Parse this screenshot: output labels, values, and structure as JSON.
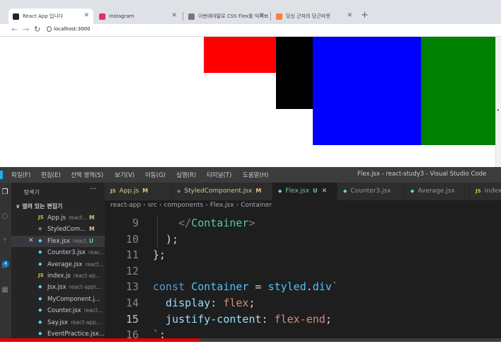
{
  "browser": {
    "tabs": [
      {
        "label": "React App 입니다",
        "favicon_color": "#20232a",
        "active": true
      },
      {
        "label": "Instagram",
        "favicon_color": "#e1306c",
        "active": false
      },
      {
        "label": "이번에야말로 CSS Flex를 익혀보자",
        "favicon_color": "#777777",
        "active": false
      },
      {
        "label": "당신 근처의 당근마켓",
        "favicon_color": "#ff7e36",
        "active": false
      }
    ],
    "new_tab": "+",
    "url": "localhost:3000",
    "boxes": [
      {
        "color": "#ff0000",
        "name": "red-box"
      },
      {
        "color": "#000000",
        "name": "black-box"
      },
      {
        "color": "#0000ff",
        "name": "blue-box"
      },
      {
        "color": "#008000",
        "name": "green-box"
      }
    ]
  },
  "vscode": {
    "menu": [
      "파일(F)",
      "편집(E)",
      "선택 영역(S)",
      "보기(V)",
      "이동(G)",
      "실행(R)",
      "터미널(T)",
      "도움말(H)"
    ],
    "window_title": "Flex.jsx - react-study3 - Visual Studio Code",
    "scm_badge": "4",
    "explorer": {
      "title": "탐색기",
      "dots": "···",
      "open_editors": "∨ 열려 있는 편집기",
      "files": [
        {
          "icon": "JS",
          "icon_color": "#cbcb41",
          "name": "App.js",
          "path": "react...",
          "status": "M",
          "status_color": "#e2c08d",
          "active": false
        },
        {
          "icon": "◆",
          "icon_color": "#6d8086",
          "name": "StyledCom...",
          "path": "",
          "status": "M",
          "status_color": "#e2c08d",
          "active": false
        },
        {
          "icon": "◆",
          "icon_color": "#61dafb",
          "name": "Flex.jsx",
          "path": "react...",
          "status": "U",
          "status_color": "#73c991",
          "active": true
        },
        {
          "icon": "◆",
          "icon_color": "#61dafb",
          "name": "Counter3.jsx",
          "path": "reac...",
          "status": "",
          "status_color": "",
          "active": false
        },
        {
          "icon": "◆",
          "icon_color": "#61dafb",
          "name": "Average.jsx",
          "path": "react...",
          "status": "",
          "status_color": "",
          "active": false
        },
        {
          "icon": "JS",
          "icon_color": "#cbcb41",
          "name": "index.js",
          "path": "react-ap...",
          "status": "",
          "status_color": "",
          "active": false
        },
        {
          "icon": "◆",
          "icon_color": "#61dafb",
          "name": "Jsx.jsx",
          "path": "react-app\\...",
          "status": "",
          "status_color": "",
          "active": false
        },
        {
          "icon": "◆",
          "icon_color": "#61dafb",
          "name": "MyComponent.j...",
          "path": "",
          "status": "",
          "status_color": "",
          "active": false
        },
        {
          "icon": "◆",
          "icon_color": "#61dafb",
          "name": "Counter.jsx",
          "path": "react...",
          "status": "",
          "status_color": "",
          "active": false
        },
        {
          "icon": "◆",
          "icon_color": "#61dafb",
          "name": "Say.jsx",
          "path": "react-app...",
          "status": "",
          "status_color": "",
          "active": false
        },
        {
          "icon": "◆",
          "icon_color": "#61dafb",
          "name": "EventPractice.jsx...",
          "path": "",
          "status": "",
          "status_color": "",
          "active": false
        }
      ]
    },
    "tabs": [
      {
        "icon": "JS",
        "icon_color": "#cbcb41",
        "label": "App.js",
        "status": "M",
        "status_color": "#e2c08d",
        "active": false
      },
      {
        "icon": "◆",
        "icon_color": "#6d8086",
        "label": "StyledComponent.jsx",
        "status": "M",
        "status_color": "#e2c08d",
        "active": false
      },
      {
        "icon": "◆",
        "icon_color": "#61dafb",
        "label": "Flex.jsx",
        "status": "U",
        "status_color": "#73c991",
        "active": true
      },
      {
        "icon": "◆",
        "icon_color": "#61dafb",
        "label": "Counter3.jsx",
        "status": "",
        "status_color": "",
        "active": false
      },
      {
        "icon": "◆",
        "icon_color": "#61dafb",
        "label": "Average.jsx",
        "status": "",
        "status_color": "",
        "active": false
      },
      {
        "icon": "JS",
        "icon_color": "#cbcb41",
        "label": "index.",
        "status": "",
        "status_color": "",
        "active": false
      }
    ],
    "breadcrumbs": [
      "react-app",
      "src",
      "components",
      "Flex.jsx",
      "Container"
    ],
    "code": [
      {
        "num": "9",
        "parts": [
          [
            "tok-punct",
            "    </"
          ],
          [
            "tok-tag",
            "Container"
          ],
          [
            "tok-punct",
            ">"
          ]
        ]
      },
      {
        "num": "10",
        "parts": [
          [
            "tok-text",
            "  );"
          ]
        ]
      },
      {
        "num": "11",
        "parts": [
          [
            "tok-text",
            "};"
          ]
        ]
      },
      {
        "num": "12",
        "parts": []
      },
      {
        "num": "13",
        "parts": [
          [
            "tok-kw",
            "const "
          ],
          [
            "tok-fn",
            "Container"
          ],
          [
            "tok-text",
            " = "
          ],
          [
            "tok-fn",
            "styled"
          ],
          [
            "tok-text",
            "."
          ],
          [
            "tok-fn",
            "div"
          ],
          [
            "tok-str",
            "`"
          ]
        ]
      },
      {
        "num": "14",
        "parts": [
          [
            "tok-prop",
            "  display"
          ],
          [
            "tok-text",
            ": "
          ],
          [
            "tok-val",
            "flex"
          ],
          [
            "tok-text",
            ";"
          ]
        ]
      },
      {
        "num": "15",
        "parts": [
          [
            "tok-prop",
            "  justify-content"
          ],
          [
            "tok-text",
            ": "
          ],
          [
            "tok-val",
            "flex-end"
          ],
          [
            "tok-text",
            ";"
          ]
        ]
      },
      {
        "num": "16",
        "parts": [
          [
            "tok-str",
            "`"
          ],
          [
            "tok-text",
            ";"
          ]
        ]
      }
    ],
    "progress": 0.4
  }
}
